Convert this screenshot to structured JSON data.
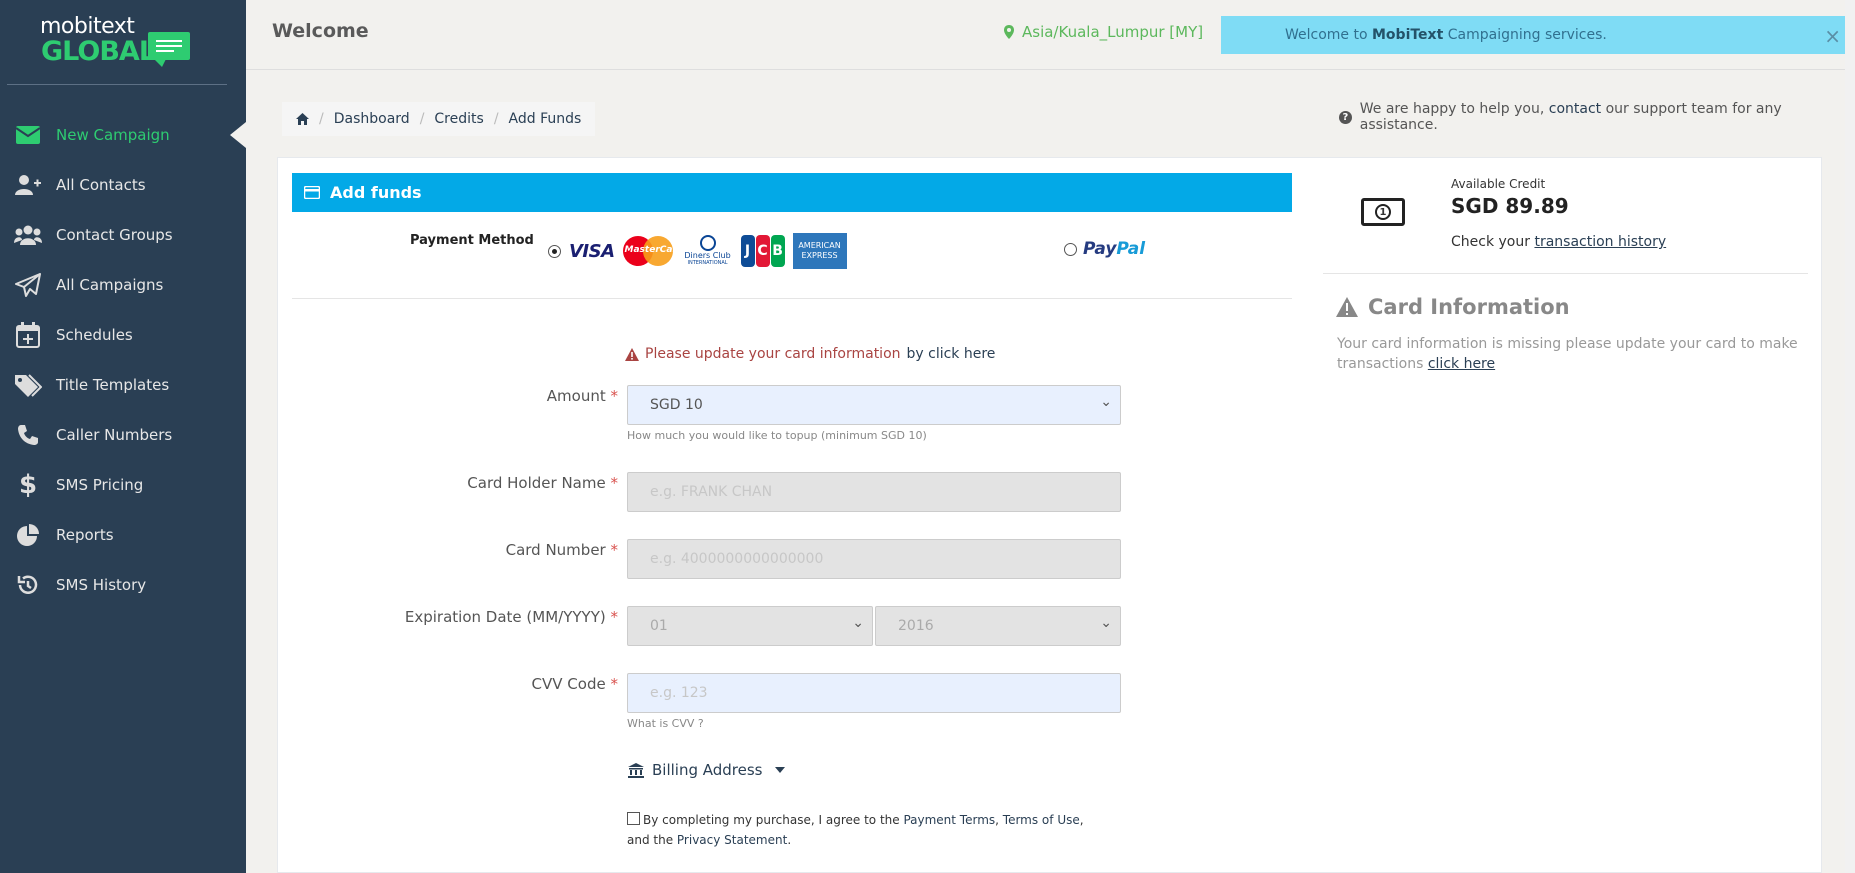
{
  "brand": {
    "line1": "mobitext",
    "line2": "GLOBAL"
  },
  "sidebar": {
    "items": [
      {
        "label": "New Campaign",
        "icon": "envelope-icon",
        "active": true
      },
      {
        "label": "All Contacts",
        "icon": "user-plus-icon"
      },
      {
        "label": "Contact Groups",
        "icon": "users-icon"
      },
      {
        "label": "All Campaigns",
        "icon": "paper-plane-icon"
      },
      {
        "label": "Schedules",
        "icon": "calendar-plus-icon"
      },
      {
        "label": "Title Templates",
        "icon": "tags-icon"
      },
      {
        "label": "Caller Numbers",
        "icon": "phone-icon"
      },
      {
        "label": "SMS Pricing",
        "icon": "dollar-icon"
      },
      {
        "label": "Reports",
        "icon": "pie-chart-icon"
      },
      {
        "label": "SMS History",
        "icon": "history-icon"
      }
    ]
  },
  "header": {
    "title": "Welcome",
    "timezone": "Asia/Kuala_Lumpur [MY]",
    "alert": {
      "prefix": "Welcome to ",
      "brand": "MobiText",
      "suffix": " Campaigning services.",
      "close": "×"
    }
  },
  "breadcrumb": [
    "Dashboard",
    "Credits",
    "Add Funds"
  ],
  "help": {
    "prefix": "We are happy to help you, ",
    "link": "contact",
    "suffix": " our support team for any assistance."
  },
  "form": {
    "panel_title": "Add funds",
    "payment_method_label": "Payment Method",
    "card_brands": {
      "visa": "VISA",
      "mastercard": "MasterCard",
      "diners": "Diners Club",
      "diners_sub": "INTERNATIONAL",
      "jcb": [
        "J",
        "C",
        "B"
      ],
      "amex1": "AMERICAN",
      "amex2": "EXPRESS"
    },
    "paypal": {
      "a": "Pay",
      "b": "Pal"
    },
    "warning": {
      "text": "Please update your card information",
      "link": "by click here"
    },
    "amount": {
      "label": "Amount",
      "value": "SGD 10",
      "hint": "How much you would like to topup (minimum SGD 10)"
    },
    "card_holder": {
      "label": "Card Holder Name",
      "placeholder": "e.g. FRANK CHAN"
    },
    "card_number": {
      "label": "Card Number",
      "placeholder": "e.g. 4000000000000000"
    },
    "expiry": {
      "label": "Expiration Date (MM/YYYY)",
      "month": "01",
      "year": "2016"
    },
    "cvv": {
      "label": "CVV Code",
      "placeholder": "e.g. 123",
      "hint": "What is CVV ?"
    },
    "required_mark": "*",
    "billing_label": "Billing Address",
    "agree": {
      "text": "By completing my purchase, I agree to the ",
      "terms": "Payment Terms",
      "sep1": ", ",
      "tou": "Terms of Use",
      "sep2": ", and the ",
      "privacy": "Privacy Statement",
      "end": "."
    }
  },
  "credit": {
    "label": "Available Credit",
    "value": "SGD 89.89",
    "check_prefix": "Check your ",
    "check_link": "transaction history"
  },
  "card_info": {
    "title": "Card Information",
    "text": "Your card information is missing please update your card to make transactions ",
    "link": "click here"
  },
  "colors": {
    "sidebar": "#2a3f54",
    "accent": "#2ecc71",
    "panel_header": "#03a9e7",
    "alert_bg": "#7fdcf5",
    "warning": "#a94442"
  }
}
